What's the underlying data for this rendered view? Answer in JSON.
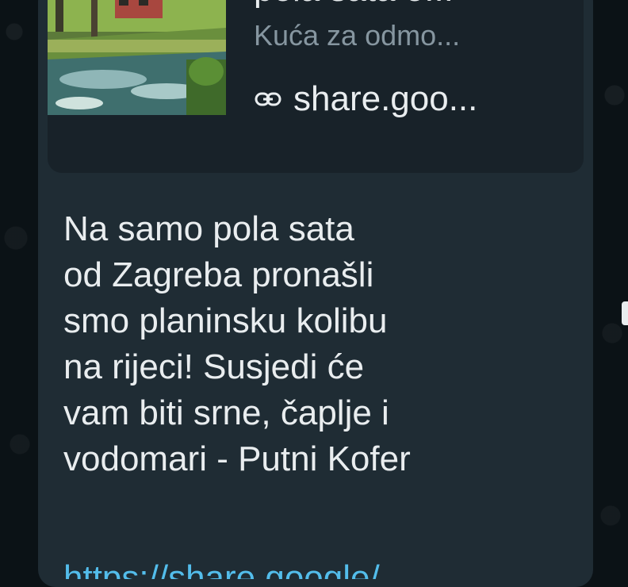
{
  "link_preview": {
    "title": "pola sata o...",
    "description": "Kuća za odmo...",
    "domain": "share.goo...",
    "link_icon": "link-icon"
  },
  "message": {
    "lines": [
      "Na samo pola sata",
      "od Zagreba pronašli",
      "smo planinsku kolibu",
      "na rijeci! Susjedi će",
      "vam biti srne, čaplje i",
      "vodomari - Putni Kofer"
    ],
    "link_partial": "https://share.google/"
  },
  "colors": {
    "bubble": "#1f2c34",
    "preview_bg": "#182229",
    "text_primary": "#e9edef",
    "text_secondary": "#8696a0",
    "link": "#53bdeb"
  }
}
